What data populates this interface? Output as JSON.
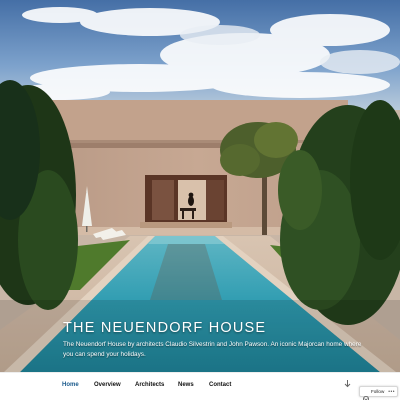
{
  "site": {
    "title": "THE NEUENDORF HOUSE",
    "description": "The Neuendorf House by architects Claudio Silvestrin and John Pawson. An iconic Majorcan home where you can spend your holidays."
  },
  "nav": {
    "items": [
      {
        "label": "Home",
        "active": true
      },
      {
        "label": "Overview",
        "active": false
      },
      {
        "label": "Architects",
        "active": false
      },
      {
        "label": "News",
        "active": false
      },
      {
        "label": "Contact",
        "active": false
      }
    ],
    "more_icon": "chevron-down-icon"
  },
  "follow": {
    "label": "Follow",
    "icon": "wordpress-icon",
    "more_icon": "ellipsis-icon"
  },
  "colors": {
    "accent": "#1a5a8c",
    "text": "#111111",
    "sky": "#5a86b9",
    "pool": "#39a6b8"
  }
}
